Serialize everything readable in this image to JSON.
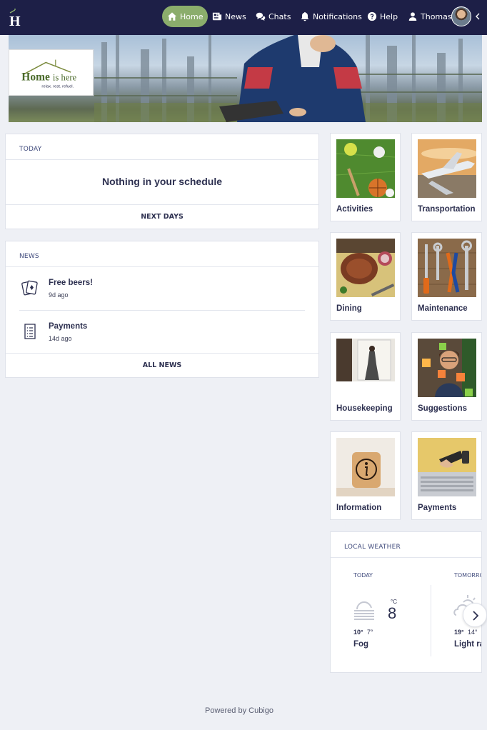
{
  "nav": {
    "home": "Home",
    "news": "News",
    "chats": "Chats",
    "notifications": "Notifications",
    "help": "Help",
    "user": "Thomas",
    "colors": {
      "bar": "#1d1f47",
      "active": "#8bad6c"
    }
  },
  "hero": {
    "logo_text": "Home is here",
    "logo_tagline": "relax. rest. refuel."
  },
  "schedule": {
    "heading": "TODAY",
    "empty_text": "Nothing in your schedule",
    "footer_link": "NEXT DAYS"
  },
  "news": {
    "heading": "NEWS",
    "items": [
      {
        "title": "Free beers!",
        "ago": "9d ago",
        "icon": "cards-icon"
      },
      {
        "title": "Payments",
        "ago": "14d ago",
        "icon": "document-icon"
      }
    ],
    "footer_link": "ALL NEWS"
  },
  "tiles": [
    {
      "label": "Activities"
    },
    {
      "label": "Transportation"
    },
    {
      "label": "Dining"
    },
    {
      "label": "Maintenance"
    },
    {
      "label": "Housekeeping"
    },
    {
      "label": "Suggestions"
    },
    {
      "label": "Information"
    },
    {
      "label": "Payments"
    }
  ],
  "weather": {
    "heading": "LOCAL WEATHER",
    "today": {
      "day": "TODAY",
      "unit": "°C",
      "temp": "8",
      "high": "10°",
      "low": "7°",
      "condition": "Fog",
      "icon": "fog-icon"
    },
    "tomorrow": {
      "day": "TOMORROW",
      "high": "19°",
      "low": "14°",
      "condition": "Light rain",
      "icon": "cloud-sun-icon"
    }
  },
  "footer": {
    "text": "Powered by Cubigo"
  }
}
